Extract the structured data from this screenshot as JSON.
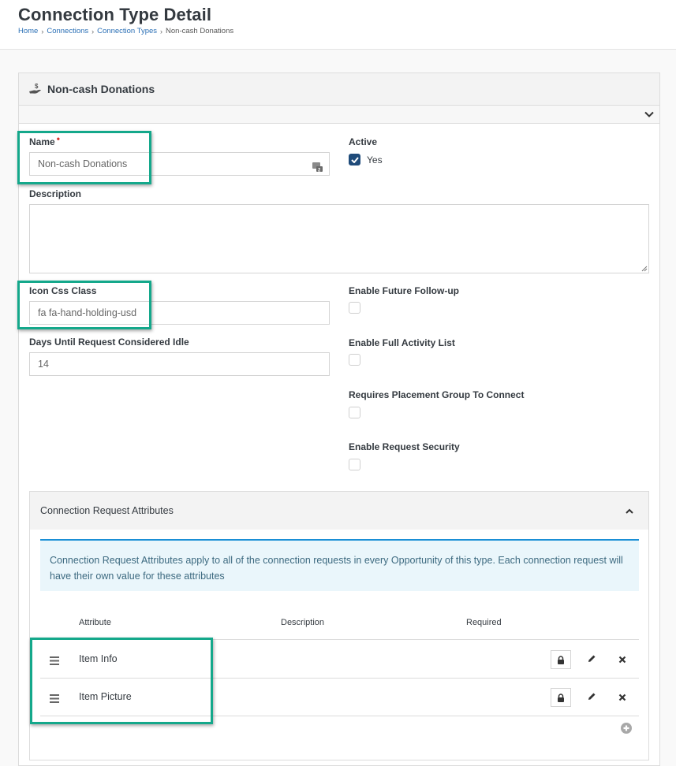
{
  "header": {
    "title": "Connection Type Detail",
    "breadcrumb": [
      {
        "label": "Home",
        "link": true
      },
      {
        "label": "Connections",
        "link": true
      },
      {
        "label": "Connection Types",
        "link": true
      },
      {
        "label": "Non-cash Donations",
        "link": false
      }
    ],
    "separator": ">"
  },
  "panel": {
    "title": "Non-cash Donations",
    "icon": "hand-holding-usd-icon"
  },
  "form": {
    "name": {
      "label": "Name",
      "required": true,
      "value": "Non-cash Donations"
    },
    "active": {
      "label": "Active",
      "option_label": "Yes",
      "checked": true
    },
    "description": {
      "label": "Description",
      "value": ""
    },
    "icon_css_class": {
      "label": "Icon Css Class",
      "value": "fa fa-hand-holding-usd"
    },
    "days_idle": {
      "label": "Days Until Request Considered Idle",
      "value": "14"
    },
    "enable_future_followup": {
      "label": "Enable Future Follow-up",
      "checked": false
    },
    "enable_full_activity_list": {
      "label": "Enable Full Activity List",
      "checked": false
    },
    "requires_placement_group": {
      "label": "Requires Placement Group To Connect",
      "checked": false
    },
    "enable_request_security": {
      "label": "Enable Request Security",
      "checked": false
    }
  },
  "attributes": {
    "title": "Connection Request Attributes",
    "info": "Connection Request Attributes apply to all of the connection requests in every Opportunity of this type. Each connection request will have their own value for these attributes",
    "columns": [
      "Attribute",
      "Description",
      "Required"
    ],
    "rows": [
      {
        "name": "Item Info",
        "description": "",
        "required": ""
      },
      {
        "name": "Item Picture",
        "description": "",
        "required": ""
      }
    ]
  },
  "colors": {
    "highlight": "#14a88b",
    "link": "#2a6fb5",
    "checkbox_checked": "#1f4b7a",
    "alert_border": "#1a8fd6",
    "alert_bg": "#eaf6fb",
    "required_dot": "#d9322b"
  }
}
